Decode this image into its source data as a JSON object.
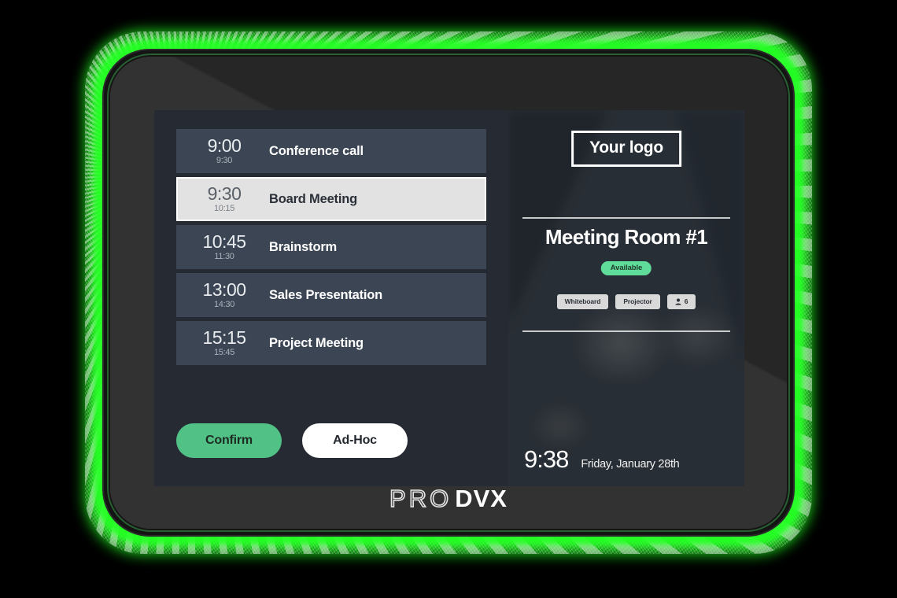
{
  "device": {
    "brand_pro": "PRO",
    "brand_dvx": "DVX",
    "glow_color": "#1ef01e",
    "bezel_color": "#2e2e2e"
  },
  "screen": {
    "background": "#262b33",
    "accent_green": "#51c186",
    "badge_green": "#5fdc9a"
  },
  "agenda": {
    "rows": [
      {
        "start": "9:00",
        "end": "9:30",
        "title": "Conference call",
        "selected": false
      },
      {
        "start": "9:30",
        "end": "10:15",
        "title": "Board Meeting",
        "selected": true
      },
      {
        "start": "10:45",
        "end": "11:30",
        "title": "Brainstorm",
        "selected": false
      },
      {
        "start": "13:00",
        "end": "14:30",
        "title": "Sales Presentation",
        "selected": false
      },
      {
        "start": "15:15",
        "end": "15:45",
        "title": "Project Meeting",
        "selected": false
      }
    ]
  },
  "actions": {
    "confirm_label": "Confirm",
    "adhoc_label": "Ad-Hoc"
  },
  "room": {
    "logo_text": "Your logo",
    "name": "Meeting Room #1",
    "status": "Available",
    "amenities": [
      {
        "label": "Whiteboard",
        "icon": ""
      },
      {
        "label": "Projector",
        "icon": ""
      }
    ],
    "capacity": "6",
    "capacity_icon": "person-icon",
    "time": "9:38",
    "date": "Friday, January 28th"
  }
}
